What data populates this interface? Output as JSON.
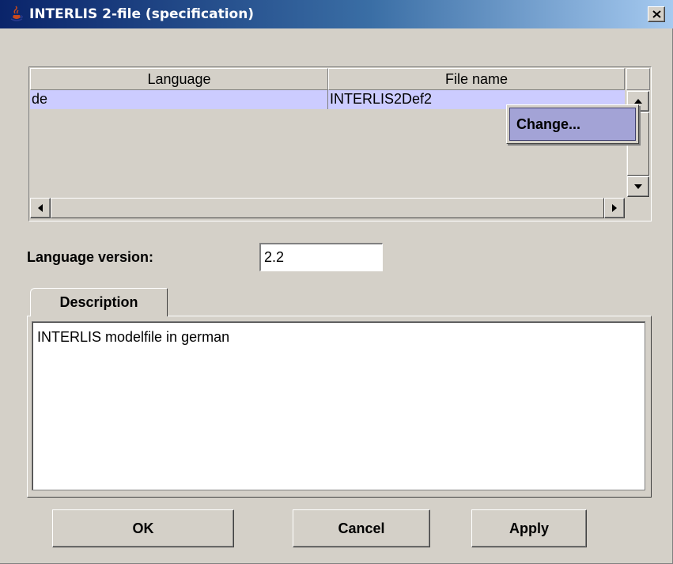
{
  "window": {
    "title": "INTERLIS 2-file (specification)",
    "title_icon": "java-cup-icon",
    "close_icon": "close-icon"
  },
  "table": {
    "columns": [
      "Language",
      "File name"
    ],
    "rows": [
      {
        "language": "de",
        "file_name": "INTERLIS2Def2"
      }
    ],
    "selected_row_color": "#ccccff"
  },
  "context_menu": {
    "items": [
      "Change..."
    ]
  },
  "language_version": {
    "label": "Language version:",
    "value": "2.2"
  },
  "tabs": [
    {
      "label": "Description",
      "active": true
    }
  ],
  "description": {
    "text": "INTERLIS modelfile in german"
  },
  "buttons": {
    "ok": "OK",
    "cancel": "Cancel",
    "apply": "Apply"
  },
  "colors": {
    "titlebar_start": "#0a246a",
    "titlebar_end": "#a6caf0",
    "background": "#d4d0c8",
    "menu_highlight": "#a3a3d6"
  }
}
